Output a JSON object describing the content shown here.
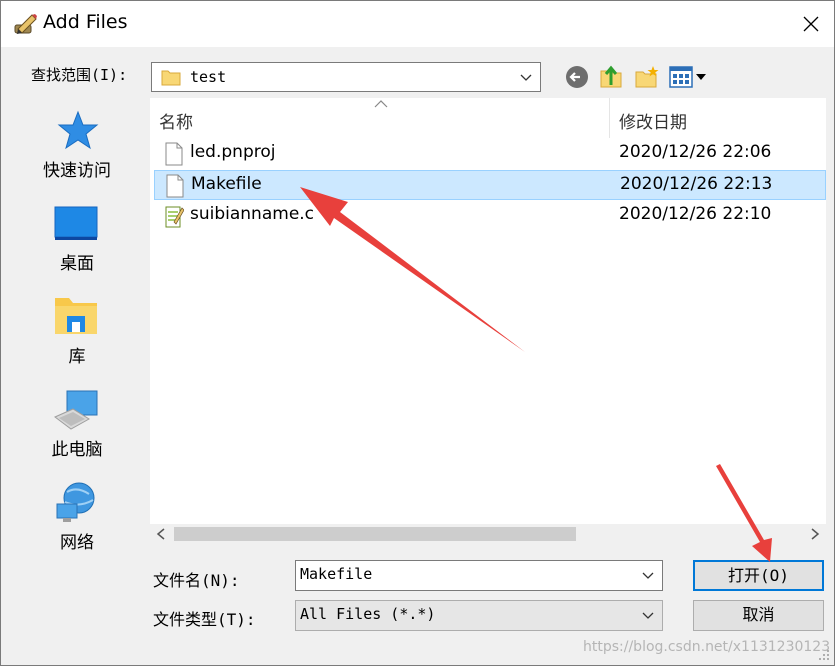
{
  "window": {
    "title": "Add Files"
  },
  "look_in": {
    "label": "查找范围(I):",
    "value": "test"
  },
  "places": [
    {
      "label": "快速访问",
      "icon": "star-icon"
    },
    {
      "label": "桌面",
      "icon": "desktop-icon"
    },
    {
      "label": "库",
      "icon": "library-folder-icon"
    },
    {
      "label": "此电脑",
      "icon": "computer-icon"
    },
    {
      "label": "网络",
      "icon": "network-icon"
    }
  ],
  "columns": {
    "name": "名称",
    "date": "修改日期"
  },
  "files": [
    {
      "name": "led.pnproj",
      "date": "2020/12/26 22:06",
      "icon": "file-icon",
      "selected": false
    },
    {
      "name": "Makefile",
      "date": "2020/12/26 22:13",
      "icon": "file-icon",
      "selected": true
    },
    {
      "name": "suibianname.c",
      "date": "2020/12/26 22:10",
      "icon": "c-source-file-icon",
      "selected": false
    }
  ],
  "filename": {
    "label": "文件名(N):",
    "value": "Makefile"
  },
  "filetype": {
    "label": "文件类型(T):",
    "value": "All Files (*.*)"
  },
  "buttons": {
    "open": "打开(O)",
    "cancel": "取消"
  },
  "watermark": "https://blog.csdn.net/x1131230123",
  "colors": {
    "selection": "#cce8ff",
    "default_button_border": "#0078d7",
    "annotation_arrow": "#e8403c"
  }
}
